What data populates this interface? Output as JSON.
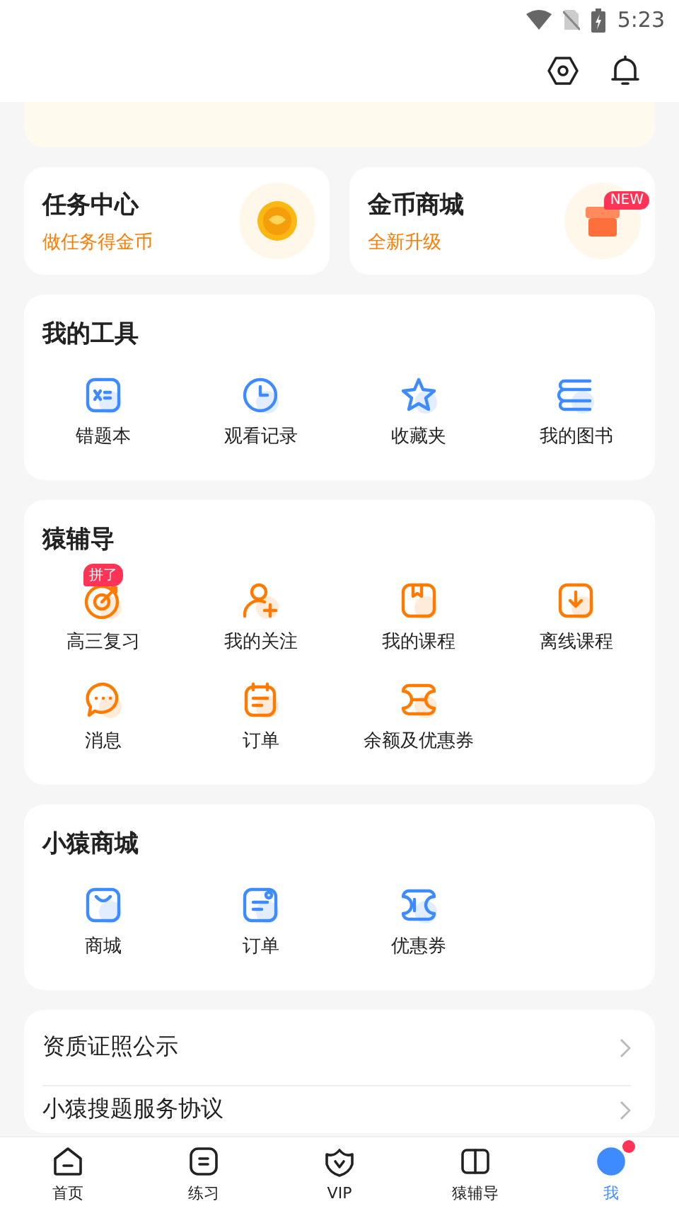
{
  "status_bar": {
    "time": "5:23"
  },
  "promo_cards": [
    {
      "title": "任务中心",
      "subtitle": "做任务得金币"
    },
    {
      "title": "金币商城",
      "subtitle": "全新升级",
      "badge": "NEW"
    }
  ],
  "sections": [
    {
      "title": "我的工具",
      "color": "#3d8bff",
      "items": [
        {
          "label": "错题本"
        },
        {
          "label": "观看记录"
        },
        {
          "label": "收藏夹"
        },
        {
          "label": "我的图书"
        }
      ]
    },
    {
      "title": "猿辅导",
      "color": "#ff7a00",
      "items": [
        {
          "label": "高三复习",
          "badge": "拼了"
        },
        {
          "label": "我的关注"
        },
        {
          "label": "我的课程"
        },
        {
          "label": "离线课程"
        },
        {
          "label": "消息"
        },
        {
          "label": "订单"
        },
        {
          "label": "余额及优惠券"
        }
      ]
    },
    {
      "title": "小猿商城",
      "color": "#3d8bff",
      "items": [
        {
          "label": "商城"
        },
        {
          "label": "订单"
        },
        {
          "label": "优惠券"
        }
      ]
    }
  ],
  "links": [
    {
      "label": "资质证照公示"
    },
    {
      "label": "小猿搜题服务协议"
    }
  ],
  "tabs": [
    {
      "label": "首页",
      "selected": false,
      "dot": false
    },
    {
      "label": "练习",
      "selected": false,
      "dot": false
    },
    {
      "label": "VIP",
      "selected": false,
      "dot": false
    },
    {
      "label": "猿辅导",
      "selected": false,
      "dot": false
    },
    {
      "label": "我",
      "selected": true,
      "dot": true
    }
  ]
}
